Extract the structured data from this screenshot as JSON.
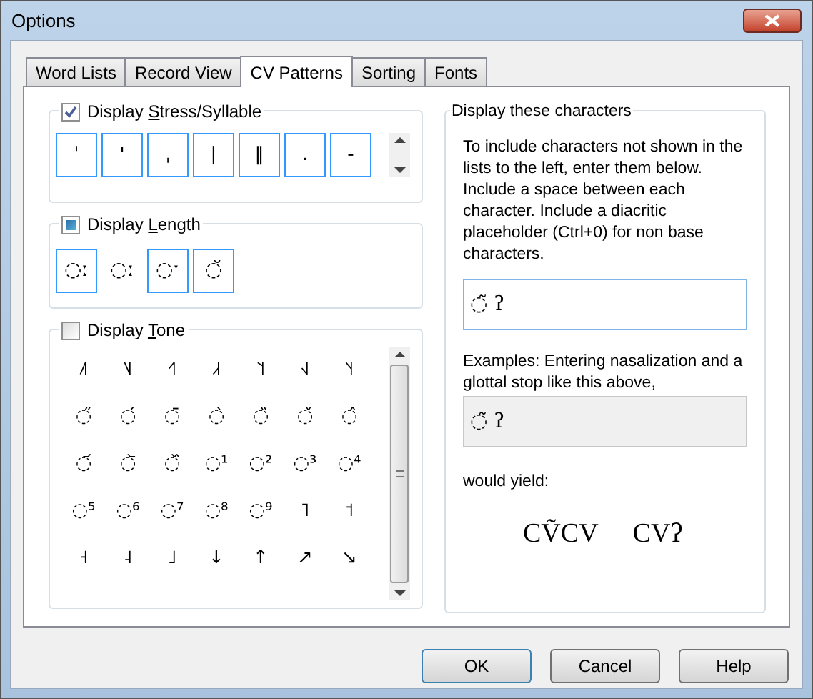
{
  "window": {
    "title": "Options"
  },
  "tabs": [
    {
      "label": "Word Lists",
      "selected": false
    },
    {
      "label": "Record View",
      "selected": false
    },
    {
      "label": "CV Patterns",
      "selected": true
    },
    {
      "label": "Sorting",
      "selected": false
    },
    {
      "label": "Fonts",
      "selected": false
    }
  ],
  "stress_group": {
    "label_parts": [
      "Display ",
      "S",
      "tress/Syllable"
    ],
    "checked": true,
    "items": [
      {
        "symbol": "ˈ",
        "selected": true
      },
      {
        "symbol": "'",
        "selected": true
      },
      {
        "symbol": "ˌ",
        "selected": true
      },
      {
        "symbol": "|",
        "selected": true
      },
      {
        "symbol": "‖",
        "selected": true
      },
      {
        "symbol": ".",
        "selected": true
      },
      {
        "symbol": "-",
        "selected": true
      }
    ]
  },
  "length_group": {
    "label_parts": [
      "Display ",
      "L",
      "ength"
    ],
    "checked": false,
    "indeterminate": true,
    "items": [
      {
        "symbol": "◌ː",
        "selected": true
      },
      {
        "symbol": "◌ː",
        "selected": false
      },
      {
        "symbol": "◌ˑ",
        "selected": true
      },
      {
        "symbol": "◌̆",
        "selected": true
      }
    ]
  },
  "tone_group": {
    "label_parts": [
      "Display ",
      "T",
      "one"
    ],
    "checked": false,
    "items": [
      {
        "symbol": "˩˥",
        "selected": false
      },
      {
        "symbol": "˥˩",
        "selected": false
      },
      {
        "symbol": "˧˥",
        "selected": false
      },
      {
        "symbol": "˩˧",
        "selected": false
      },
      {
        "symbol": "˥˦",
        "selected": false
      },
      {
        "symbol": "˧˩",
        "selected": false
      },
      {
        "symbol": "˥˧",
        "selected": false
      },
      {
        "symbol": "◌̋",
        "selected": false
      },
      {
        "symbol": "◌́",
        "selected": false
      },
      {
        "symbol": "◌̄",
        "selected": false
      },
      {
        "symbol": "◌̀",
        "selected": false
      },
      {
        "symbol": "◌̏",
        "selected": false
      },
      {
        "symbol": "◌̌",
        "selected": false
      },
      {
        "symbol": "◌̂",
        "selected": false
      },
      {
        "symbol": "◌᷄",
        "selected": false
      },
      {
        "symbol": "◌᷅",
        "selected": false
      },
      {
        "symbol": "◌᷈",
        "selected": false
      },
      {
        "symbol": "◌¹",
        "selected": false
      },
      {
        "symbol": "◌²",
        "selected": false
      },
      {
        "symbol": "◌³",
        "selected": false
      },
      {
        "symbol": "◌⁴",
        "selected": false
      },
      {
        "symbol": "◌⁵",
        "selected": false
      },
      {
        "symbol": "◌⁶",
        "selected": false
      },
      {
        "symbol": "◌⁷",
        "selected": false
      },
      {
        "symbol": "◌⁸",
        "selected": false
      },
      {
        "symbol": "◌⁹",
        "selected": false
      },
      {
        "symbol": "˥",
        "selected": false
      },
      {
        "symbol": "˦",
        "selected": false
      },
      {
        "symbol": "˧",
        "selected": false
      },
      {
        "symbol": "˨",
        "selected": false
      },
      {
        "symbol": "˩",
        "selected": false
      },
      {
        "symbol": "↓",
        "selected": false
      },
      {
        "symbol": "↑",
        "selected": false
      },
      {
        "symbol": "↗",
        "selected": false
      },
      {
        "symbol": "↘",
        "selected": false
      }
    ]
  },
  "characters_group": {
    "title": "Display these characters",
    "instructions": "To include characters not shown in the lists to the left, enter them below. Include a space between each character. Include a diacritic placeholder (Ctrl+0) for non base characters.",
    "input_value": "◌̃ ʔ",
    "examples_text": "Examples: Entering nasalization and a glottal stop like this above,",
    "example_value": "◌̃ ʔ",
    "yield_label": "would yield:",
    "yield_examples": [
      "CṼCV",
      "CVʔ"
    ]
  },
  "buttons": [
    "OK",
    "Cancel",
    "Help"
  ]
}
